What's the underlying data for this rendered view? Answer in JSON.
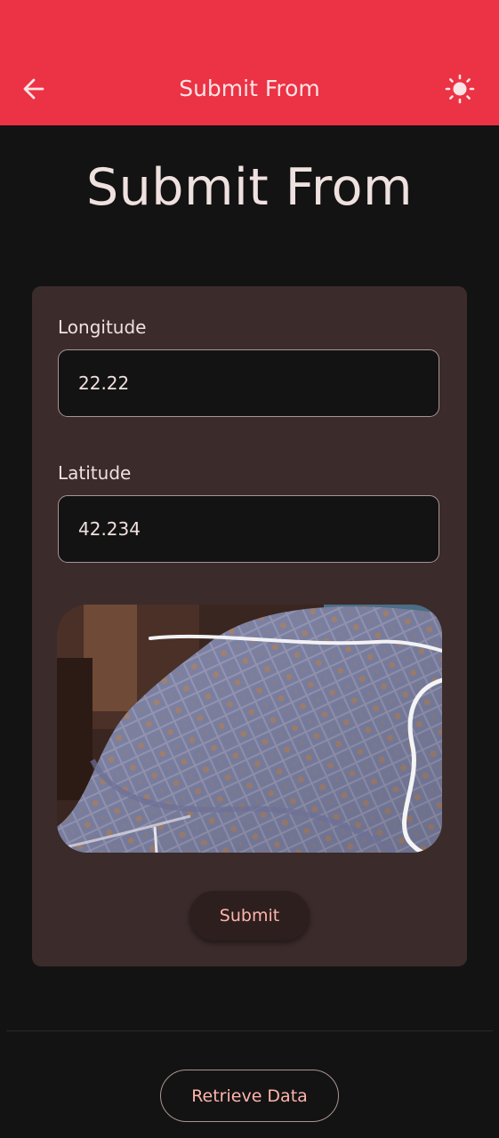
{
  "app_bar": {
    "title": "Submit From",
    "back_icon": "arrow-left-icon",
    "theme_icon": "sun-icon",
    "color": "#ec3245"
  },
  "page": {
    "title": "Submit From"
  },
  "form": {
    "longitude_label": "Longitude",
    "longitude_value": "22.22",
    "latitude_label": "Latitude",
    "latitude_value": "42.234",
    "photo_icon": "captured-photo",
    "submit_label": "Submit"
  },
  "footer": {
    "retrieve_label": "Retrieve Data"
  },
  "colors": {
    "background": "#131313",
    "card": "#3b2b2b",
    "accent_text": "#ffb4ab",
    "primary_text": "#efe1df"
  }
}
